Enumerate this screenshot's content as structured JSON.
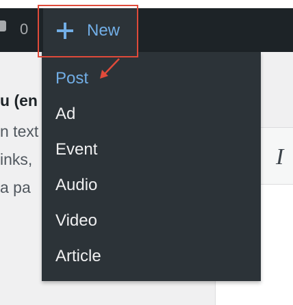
{
  "adminbar": {
    "comment_count": "0",
    "new_label": "New",
    "icons": [
      "comment-icon",
      "plus-icon"
    ]
  },
  "new_menu": {
    "items": [
      {
        "label": "Post",
        "active": true
      },
      {
        "label": "Ad"
      },
      {
        "label": "Event"
      },
      {
        "label": "Audio"
      },
      {
        "label": "Video"
      },
      {
        "label": "Article"
      }
    ]
  },
  "background_content": {
    "heading_fragment": "u (en",
    "text_lines": [
      "n text",
      "inks,",
      " a pa"
    ]
  },
  "editor": {
    "italic_glyph": "I"
  },
  "colors": {
    "adminbar": "#1d2327",
    "menu_bg": "#2c3338",
    "highlight": "#72aee6",
    "annotation": "#e04a3a"
  }
}
